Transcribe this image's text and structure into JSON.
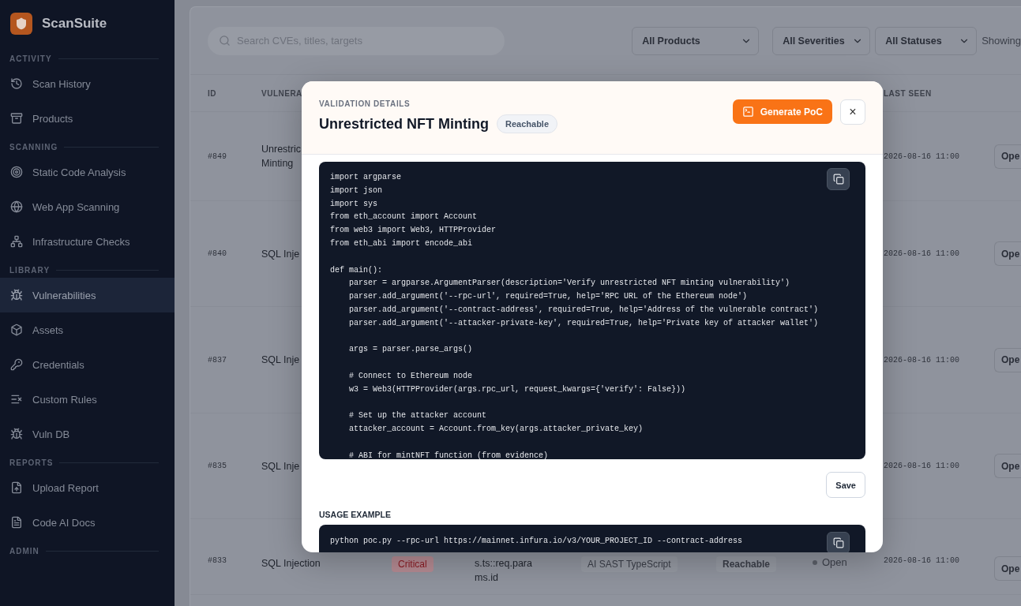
{
  "sidebar": {
    "brand": "ScanSuite",
    "sections": [
      {
        "title": "ACTIVITY",
        "items": [
          {
            "label": "Scan History",
            "selected": false
          },
          {
            "label": "Products",
            "selected": false
          }
        ]
      },
      {
        "title": "SCANNING",
        "items": [
          {
            "label": "Static Code Analysis",
            "selected": false
          },
          {
            "label": "Web App Scanning",
            "selected": false
          },
          {
            "label": "Infrastructure Checks",
            "selected": false
          }
        ]
      },
      {
        "title": "LIBRARY",
        "items": [
          {
            "label": "Vulnerabilities",
            "selected": true
          },
          {
            "label": "Assets",
            "selected": false
          },
          {
            "label": "Credentials",
            "selected": false
          },
          {
            "label": "Custom Rules",
            "selected": false
          },
          {
            "label": "Vuln DB",
            "selected": false
          }
        ]
      },
      {
        "title": "REPORTS",
        "items": [
          {
            "label": "Upload Report",
            "selected": false
          },
          {
            "label": "Code AI Docs",
            "selected": false
          }
        ]
      },
      {
        "title": "ADMIN"
      }
    ]
  },
  "toolbar": {
    "search": {
      "placeholder": "Search CVEs, titles, targets"
    },
    "filters": [
      "All Products",
      "All Severities",
      "All Statuses"
    ],
    "summary": "Showing"
  },
  "table": {
    "header": {
      "id": "ID",
      "vulnerability": "VULNERA",
      "last_seen": "LAST SEEN"
    },
    "rows": [
      {
        "id": "#849",
        "vulnerability": [
          "Unrestric",
          "Minting"
        ],
        "last_seen": "2026-08-16 11:00",
        "action": "Ope"
      },
      {
        "id": "#840",
        "vulnerability": [
          "SQL Inje"
        ],
        "last_seen": "2026-08-16 11:00",
        "action": "Ope"
      },
      {
        "id": "#837",
        "vulnerability": [
          "SQL Inje"
        ],
        "last_seen": "2026-08-16 11:00",
        "action": "Ope"
      },
      {
        "id": "#835",
        "vulnerability": [
          "SQL Inje"
        ],
        "last_seen": "2026-08-16 11:00",
        "action": "Ope"
      },
      {
        "id": "#833",
        "vulnerability": [
          "SQL Injection"
        ],
        "severity": "Critical",
        "location": [
          "s.ts::req.para",
          "ms.id"
        ],
        "source": "AI SAST TypeScript",
        "reachability": "Reachable",
        "status": "Open",
        "last_seen": "2026-08-16 11:00",
        "action": "Ope"
      }
    ]
  },
  "modal": {
    "eyebrow": "VALIDATION DETAILS",
    "title": "Unrestricted NFT Minting",
    "badge": "Reachable",
    "primary_button": "Generate PoC",
    "close": "×",
    "code": [
      [
        "import argparse",
        "import json",
        "import sys",
        "from eth_account import Account",
        "from web3 import Web3, HTTPProvider",
        "from eth_abi import encode_abi"
      ],
      [
        "def main():",
        "    parser = argparse.ArgumentParser(description='Verify unrestricted NFT minting vulnerability')",
        "    parser.add_argument('--rpc-url', required=True, help='RPC URL of the Ethereum node')",
        "    parser.add_argument('--contract-address', required=True, help='Address of the vulnerable contract')",
        "    parser.add_argument('--attacker-private-key', required=True, help='Private key of attacker wallet')"
      ],
      [
        "    args = parser.parse_args()"
      ],
      [
        "    # Connect to Ethereum node",
        "    w3 = Web3(HTTPProvider(args.rpc_url, request_kwargs={'verify': False}))"
      ],
      [
        "    # Set up the attacker account",
        "    attacker_account = Account.from_key(args.attacker_private_key)"
      ],
      [
        "    # ABI for mintNFT function (from evidence)"
      ]
    ],
    "save_button": "Save",
    "usage_title": "USAGE EXAMPLE",
    "usage": [
      "python poc.py --rpc-url https://mainnet.infura.io/v3/YOUR_PROJECT_ID --contract-address"
    ]
  }
}
